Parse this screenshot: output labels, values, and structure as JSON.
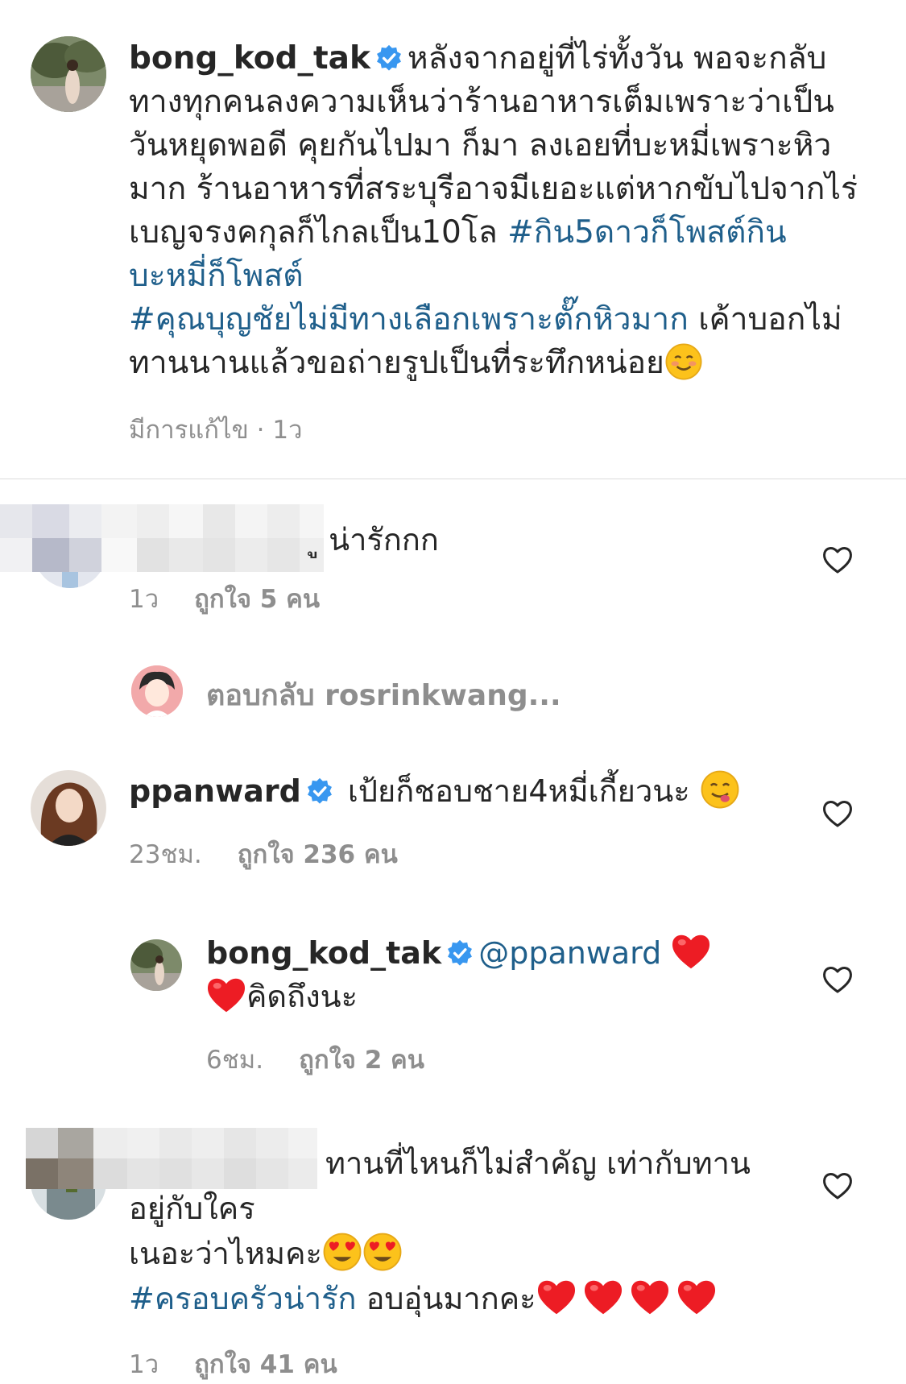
{
  "post": {
    "username": "bong_kod_tak",
    "caption_lines": [
      "หลังจากอยู่ที่ไร่ทั้งวัน พอจะกลับ",
      "ทางทุกคนลงความเห็นว่าร้านอาหารเต็มเพราะว่าเป็น",
      "วันหยุดพอดี คุยกันไปมา ก็มา ลงเอยที่บะหมี่เพราะหิว",
      "มาก ร้านอาหารที่สระบุรีอาจมีเยอะแต่หากขับไปจากไร่",
      "เบญจรงคกุลก็ไกลเป็น10โล"
    ],
    "hashtag1_part1": "#กิน5ดาวก็โพสต์กิน",
    "hashtag1_part2": "บะหมี่ก็โพสต์",
    "hashtag2": "#คุณบุญชัยไม่มีทางเลือกเพราะตั๊กหิวมาก",
    "caption_after_tag": " เค้าบอกไม่",
    "caption_last": "ทานนานแล้วขอถ่ายรูปเป็นที่ระทึกหน่อย",
    "meta": "มีการแก้ไข · 1ว"
  },
  "comments": [
    {
      "text": "น่ารักกก",
      "time": "1ว",
      "likes": "ถูกใจ 5 คน"
    },
    {
      "view_replies": "ตอบกลับ rosrinkwang..."
    },
    {
      "username": "ppanward",
      "text": "เป้ยก็ชอบชาย4หมี่เกี้ยวนะ",
      "time": "23ชม.",
      "likes": "ถูกใจ 236 คน"
    },
    {
      "username": "bong_kod_tak",
      "mention": "@ppanward",
      "text": "คิดถึงนะ",
      "time": "6ชม.",
      "likes": "ถูกใจ 2 คน"
    },
    {
      "line1": "ทานที่ไหนก็ไม่สำคัญ เท่ากับทาน",
      "line2": "อยู่กับใคร",
      "line3": "เนอะว่าไหมคะ",
      "hashtag": "#ครอบครัวน่ารัก",
      "line4": " อบอุ่นมากคะ",
      "time": "1ว",
      "likes": "ถูกใจ 41 คน"
    }
  ],
  "colors": {
    "hashtag": "#1f5f8b",
    "verified": "#3897f0",
    "muted": "#8e8e8e",
    "heart": "#ed1c24"
  },
  "icons": [
    "verified-badge-icon",
    "heart-outline-icon",
    "heart-emoji-icon",
    "smiling-emoji-icon",
    "heart-eyes-emoji-icon",
    "yum-emoji-icon"
  ]
}
